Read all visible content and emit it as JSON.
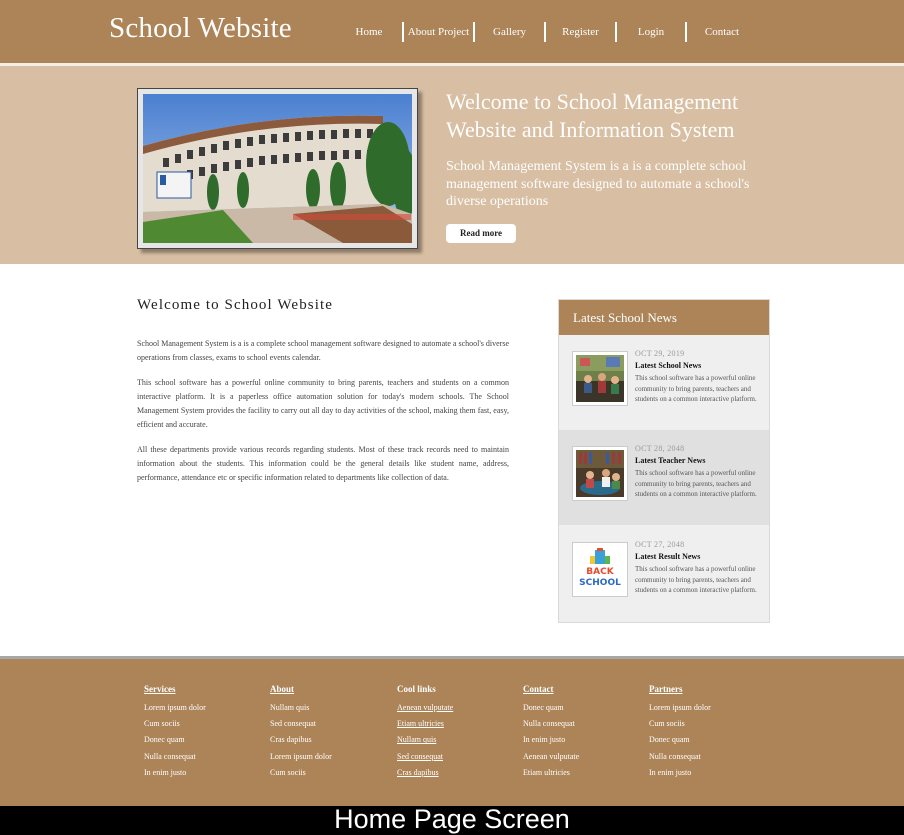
{
  "header": {
    "brand": "School Website",
    "nav": [
      "Home",
      "About Project",
      "Gallery",
      "Register",
      "Login",
      "Contact"
    ]
  },
  "hero": {
    "title": "Welcome to School Management Website and Information System",
    "text": "School Management System is a is a complete school management software designed to automate a school's diverse operations",
    "button": "Read more"
  },
  "main": {
    "heading": "Welcome to School Website",
    "paragraphs": [
      "School Management System is a is a complete school management software designed to automate a school's diverse operations from classes, exams to school events calendar.",
      "This school software has a powerful online community to bring parents, teachers and students on a common interactive platform. It is a paperless office automation solution for today's modern schools. The School Management System provides the facility to carry out all day to day activities of the school, making them fast, easy, efficient and accurate.",
      "All these departments provide various records regarding students. Most of these track records need to maintain information about the students. This information could be the general details like student name, address, performance, attendance etc or specific information related to departments like collection of data."
    ]
  },
  "news": {
    "header": "Latest School News",
    "items": [
      {
        "date": "OCT 29, 2019",
        "title": "Latest School News",
        "desc": "This school software has a powerful online community to bring parents, teachers and students on a common interactive platform."
      },
      {
        "date": "OCT 28, 2048",
        "title": "Latest Teacher News",
        "desc": "This school software has a powerful online community to bring parents, teachers and students on a common interactive platform."
      },
      {
        "date": "OCT 27, 2048",
        "title": "Latest Result News",
        "desc": "This school software has a powerful online community to bring parents, teachers and students on a common interactive platform."
      }
    ],
    "thumb3_text": [
      "BACK",
      "SCHOOL"
    ]
  },
  "footer": {
    "columns": [
      {
        "heading": "Services",
        "links": [
          "Lorem ipsum dolor",
          "Cum sociis",
          "Donec quam",
          "Nulla consequat",
          "In enim justo"
        ]
      },
      {
        "heading": "About",
        "links": [
          "Nullam quis",
          "Sed consequat",
          "Cras dapibus",
          "Lorem ipsum dolor",
          "Cum sociis"
        ]
      },
      {
        "heading": "Cool links",
        "links": [
          "Aenean vulputate",
          "Etiam ultricies",
          "Nullam quis",
          "Sed consequat",
          "Cras dapibus"
        ]
      },
      {
        "heading": "Contact",
        "links": [
          "Donec quam",
          "Nulla consequat",
          "In enim justo",
          "Aenean vulputate",
          "Etiam ultricies"
        ]
      },
      {
        "heading": "Partners",
        "links": [
          "Lorem ipsum dolor",
          "Cum sociis",
          "Donec quam",
          "Nulla consequat",
          "In enim justo"
        ]
      }
    ]
  },
  "caption": "Home Page Screen",
  "colors": {
    "brand_brown": "#ac8458",
    "hero_tan": "#d8bea2",
    "news_bg": "#efefef",
    "news_alt_bg": "#e0e0e0"
  }
}
